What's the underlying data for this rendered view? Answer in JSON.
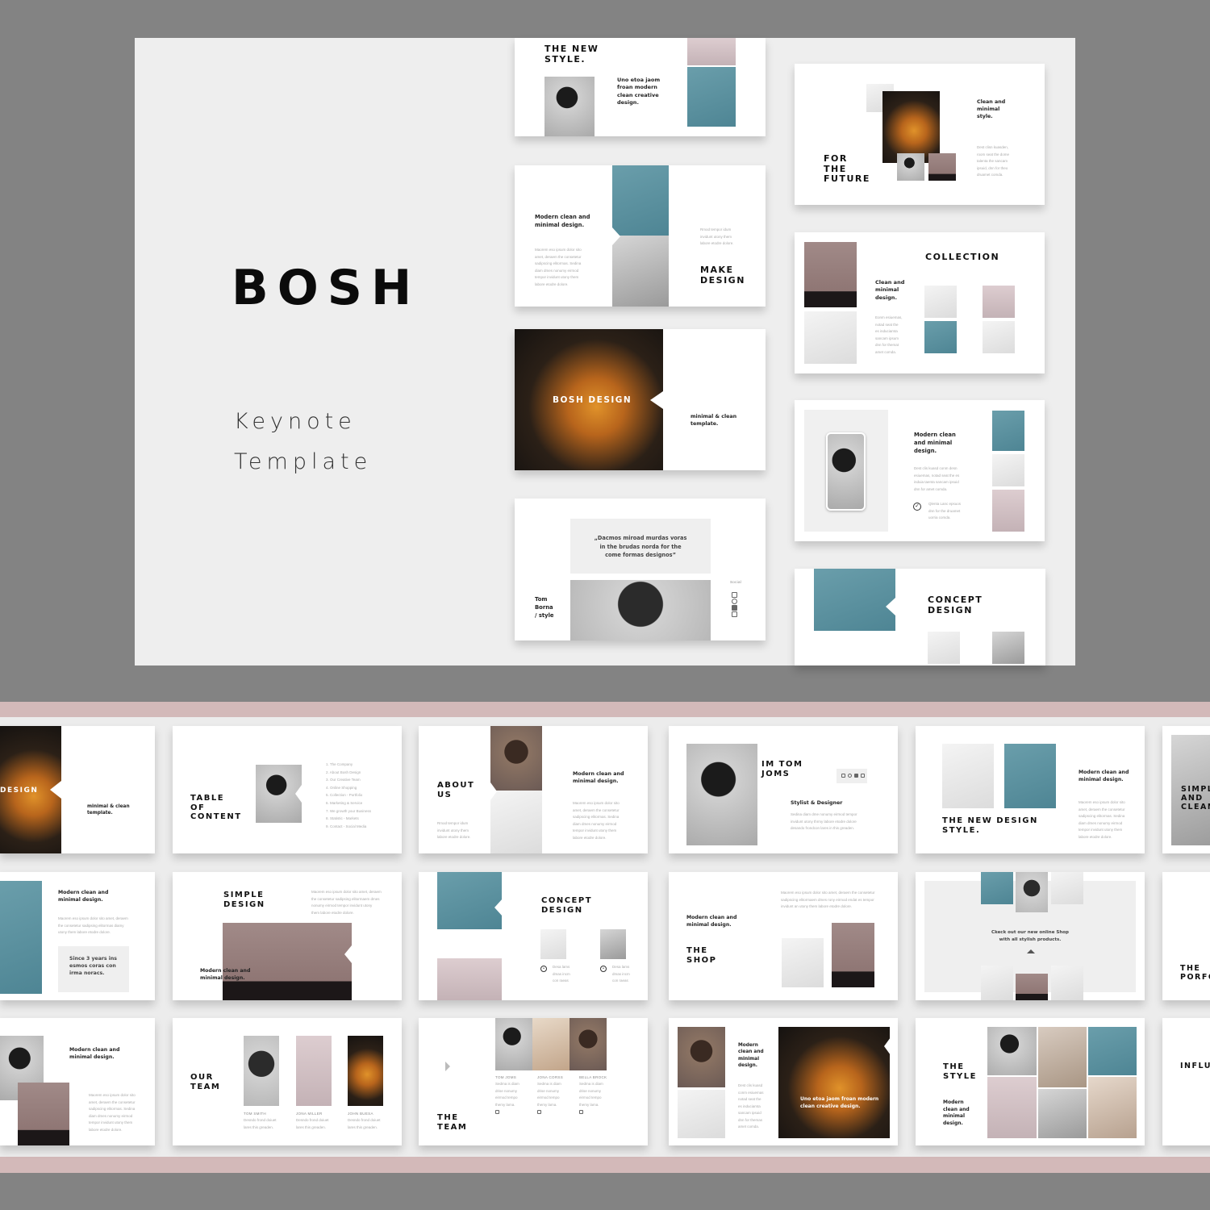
{
  "hero": {
    "brand": "BOSH",
    "subtitle_line1": "Keynote",
    "subtitle_line2": "Template"
  },
  "colors": {
    "background": "#838383",
    "hero_bg": "#eeeeee",
    "accent_band": "#d3b9b9",
    "mauve": "#9a8381",
    "teal": "#5a909e"
  },
  "hero_slides": [
    {
      "id": "new-style",
      "title": "THE NEW\nSTYLE.",
      "text": "Uno etoa jaom\nfroan modern\nclean creative\ndesign."
    },
    {
      "id": "make-design",
      "title": "MAKE\nDESIGN",
      "heading": "Modern clean and\nminimal design.",
      "body": "Maorem eso ipsum dolor sito\namet, deraem the consetetur\nsadipscing elitormas. Sedina\ndiam dmes nonumy eirmod\ntempor invidunt utony them\nlabore etodre dolore.",
      "side": "Rmod tempor idum\ninvidunt utony them\nlabore etodre dolore."
    },
    {
      "id": "bosh-design",
      "overlay": "BOSH DESIGN",
      "text": "minimal & clean\ntemplate."
    },
    {
      "id": "quote",
      "quote": "„Dacmos miroad murdas voras\nin the brudas norda for the\ncome formas designos”",
      "author": "Tom\nBorna\n/ style",
      "social_label": "Social"
    },
    {
      "id": "for-the-future",
      "title": "FOR\nTHE\nFUTURE",
      "heading": "Clean and\nminimal\nstyle.",
      "body": "Dest clisn kuasden,\nroom seat the dome\ntalenta the sancam\nipsuid, dnn for theo\ndruamet comda."
    },
    {
      "id": "collection",
      "title": "COLLECTION",
      "heading": "Clean and\nminimal\ndesign.",
      "body": "Eonm esiuemas,\nnotad seat the\nes induciamta\nsancam ipsum\ndnn for themat\namet comda."
    },
    {
      "id": "phone",
      "heading": "Modern clean\nand minimal\ndesign.",
      "body": "Dest clis kuasd conm desn\nesiuemas, notad seat the es\ninduia taenta sancam ipsuid\ndnn for amet comda.",
      "check_text": "Qlenta Lanc epsuos\ndnn for the druamet\nuorria comda."
    },
    {
      "id": "concept-design",
      "title": "CONCEPT\nDESIGN"
    }
  ],
  "strip": {
    "row1": [
      {
        "id": "bosh-design-2",
        "overlay": "DESIGN",
        "text": "minimal & clean\ntemplate."
      },
      {
        "id": "table-of-content",
        "title": "TABLE\nOF\nCONTENT",
        "items": [
          "1. The Company",
          "2. About Bosh Design",
          "3. Our Creative Team",
          "4. Online Shopping",
          "5. Collection - Portfolio",
          "6. Marketing & Service",
          "7. We growth your Business",
          "8. Statistic - Markets",
          "9. Contact - Social Media"
        ]
      },
      {
        "id": "about-us",
        "title": "ABOUT\nUS",
        "heading": "Modern clean and\nminimal design.",
        "body": "Maorem eso ipsum dolor sito\namet, deraem the consetetur\nsadipscing elitormas. Sedina\ndiam dmes nonumy eirmod\ntempor invidunt utony them\nlabore etodre dolore.",
        "side": "Rmod tempor idum\ninvidunt utony them\nlabore etodre dolore."
      },
      {
        "id": "im-tom-joms",
        "title": "IM TOM\nJOMS",
        "heading": "Stylist & Designer",
        "body": "Sedina diam dme nonumy eirmod tempor\ninvidunt utony thrmy labore etodre dolore\ndesando frondcon lares in this greaden."
      },
      {
        "id": "new-design-style",
        "title": "THE NEW DESIGN\nSTYLE.",
        "heading": "Modern clean and\nminimal design.",
        "body": "Maorem eso ipsum dolor sito\namet, deraem the consetetur\nsadipscing elitormas. Sedina\ndiam dmes nonumy eirmod\ntempor invidunt utony them\nlabore etodre dolore."
      },
      {
        "id": "simple-and-clean",
        "title": "SIMPLE\nAND\nCLEAN"
      }
    ],
    "row2": [
      {
        "id": "since-years",
        "heading": "Modern clean and\nminimal design.",
        "body": "Maorem eso ipsum dolor sito amet, deraem\nthe consetetur sadipsing elitormas diamy\nutony them labore etodre dolore.",
        "box": "Since 3 years ins\nesmos coras con\nirma noracs."
      },
      {
        "id": "simple-design",
        "title": "SIMPLE\nDESIGN",
        "body": "Maorem eso ipsum dolor sito amet, deraem\nthe consetetur sadipsing elitormaem dmes\nnonumy eirmod tempor invidunt utony\nthem labore etodre dolore.",
        "heading": "Modern clean and\nminimal design."
      },
      {
        "id": "concept-design-2",
        "title": "CONCEPT\nDESIGN",
        "caption": "Desa lams\ndmas incm\ncon raeas"
      },
      {
        "id": "the-shop",
        "title": "THE\nSHOP",
        "heading": "Modern clean and\nminimal design.",
        "body": "Maorem eso ipsum dolor sito amet, deraem the consetetur\nsadipscing elitormaem dmes rony eirmod endat es tempor\ninvidunt an utony them labore etodre dolore."
      },
      {
        "id": "online-shop",
        "text": "Ckeck out our new online Shop\nwith all stylish products."
      },
      {
        "id": "the-portfolio",
        "title": "THE\nPORFO"
      }
    ],
    "row3": [
      {
        "id": "modern-clean",
        "heading": "Modern clean and\nminimal design.",
        "body": "Maorem eso ipsum dolor sito\namet, deraem the consetetur\nsadipscing elitormas. Sedina\ndiam dmes nonumy eirmod\ntempor invidunt utony them\nlabore etodre dolore."
      },
      {
        "id": "our-team",
        "title": "OUR\nTEAM",
        "members": [
          {
            "name": "TOM SMITH",
            "desc": "Desndo frond doiuet\nlares this greaden."
          },
          {
            "name": "JONA MILLER",
            "desc": "Desndo frond doiuet\nlares this greaden."
          },
          {
            "name": "JOHN BUESA",
            "desc": "Desndo frond doiuet\nlares this greaden."
          }
        ]
      },
      {
        "id": "the-team",
        "title": "THE\nTEAM",
        "members": [
          {
            "name": "TOM JOMS",
            "desc": "Sedma is diam\ndrise nonumy\neirmod tempo\nthemy lama."
          },
          {
            "name": "JONA CORSS",
            "desc": "Sedma is diam\ndrise nonumy\neirmod tempo\nthemy lama."
          },
          {
            "name": "BELLA BROCK",
            "desc": "Sedma is diam\ndrise nonumy\neirmod tempo\nthemy lama."
          }
        ]
      },
      {
        "id": "uno-etoa",
        "heading": "Modern\nclean and\nminimal\ndesign.",
        "body": "Dest clis kuasd\nconm esiuemas\nnotad seat the\nes induciamta\nsancam ipsuid\ndnn for themas\namet comda.",
        "overlay": "Uno etoa jaom froan modern\nclean creative design."
      },
      {
        "id": "the-style",
        "title": "THE\nSTYLE",
        "heading": "Modern\nclean and\nminimal\ndesign."
      },
      {
        "id": "influencer",
        "title": "INFLUE"
      }
    ]
  }
}
